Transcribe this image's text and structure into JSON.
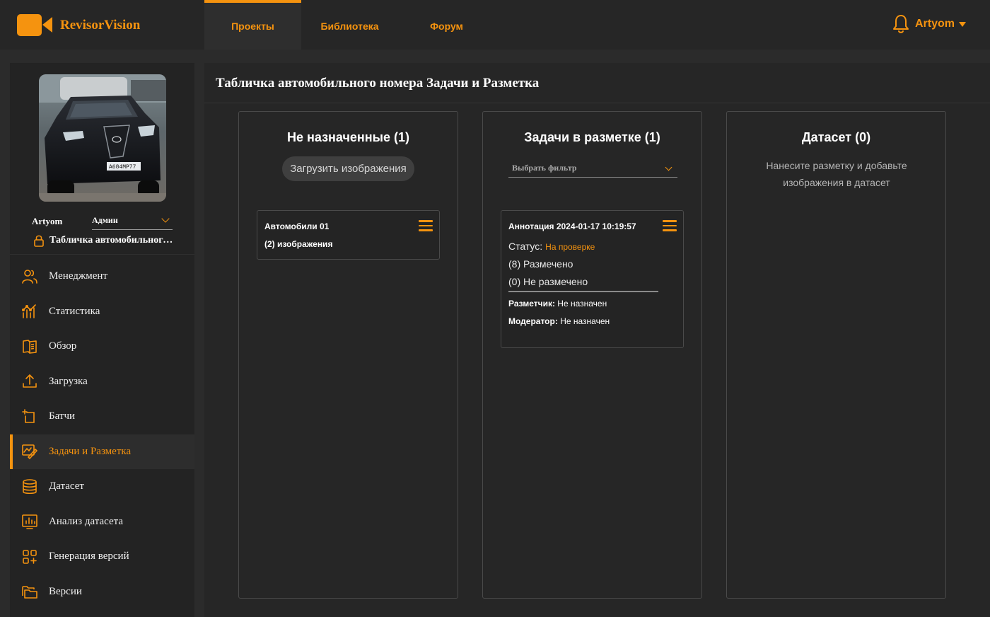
{
  "app": {
    "name": "RevisorVision",
    "brand_color": "#f5930f"
  },
  "nav": {
    "tabs": [
      {
        "label": "Проекты",
        "active": true
      },
      {
        "label": "Библиотека",
        "active": false
      },
      {
        "label": "Форум",
        "active": false
      }
    ]
  },
  "user": {
    "name": "Artyom"
  },
  "sidebar": {
    "user_name": "Artyom",
    "role": "Админ",
    "project_name": "Табличка автомобильного номера",
    "plate_text": "А684МР77",
    "items": [
      {
        "label": "Менеджмент",
        "icon": "users-icon",
        "active": false
      },
      {
        "label": "Статистика",
        "icon": "stats-icon",
        "active": false
      },
      {
        "label": "Обзор",
        "icon": "book-icon",
        "active": false
      },
      {
        "label": "Загрузка",
        "icon": "upload-icon",
        "active": false
      },
      {
        "label": "Батчи",
        "icon": "batch-icon",
        "active": false
      },
      {
        "label": "Задачи и Разметка",
        "icon": "annotate-icon",
        "active": true
      },
      {
        "label": "Датасет",
        "icon": "database-icon",
        "active": false
      },
      {
        "label": "Анализ датасета",
        "icon": "analysis-icon",
        "active": false
      },
      {
        "label": "Генерация версий",
        "icon": "grid-plus-icon",
        "active": false
      },
      {
        "label": "Версии",
        "icon": "folders-icon",
        "active": false
      }
    ]
  },
  "main": {
    "title": "Табличка автомобильного номера Задачи и Разметка",
    "columns": {
      "unassigned": {
        "title": "Не назначенные (1)",
        "upload_label": "Загрузить изображения",
        "card": {
          "title": "Автомобили 01",
          "subtitle": "(2) изображения"
        }
      },
      "annotating": {
        "title": "Задачи в разметке (1)",
        "filter_placeholder": "Выбрать фильтр",
        "card": {
          "title": "Аннотация 2024-01-17 10:19:57",
          "status_label": "Статус:",
          "status_value": "На проверке",
          "annotated": "(8) Размечено",
          "not_annotated": "(0) Не размечено",
          "annotator_label": "Разметчик:",
          "annotator_value": "Не назначен",
          "moderator_label": "Модератор:",
          "moderator_value": "Не назначен"
        }
      },
      "dataset": {
        "title": "Датасет (0)",
        "empty_message": "Нанесите разметку и добавьте изображения в датасет"
      }
    }
  }
}
